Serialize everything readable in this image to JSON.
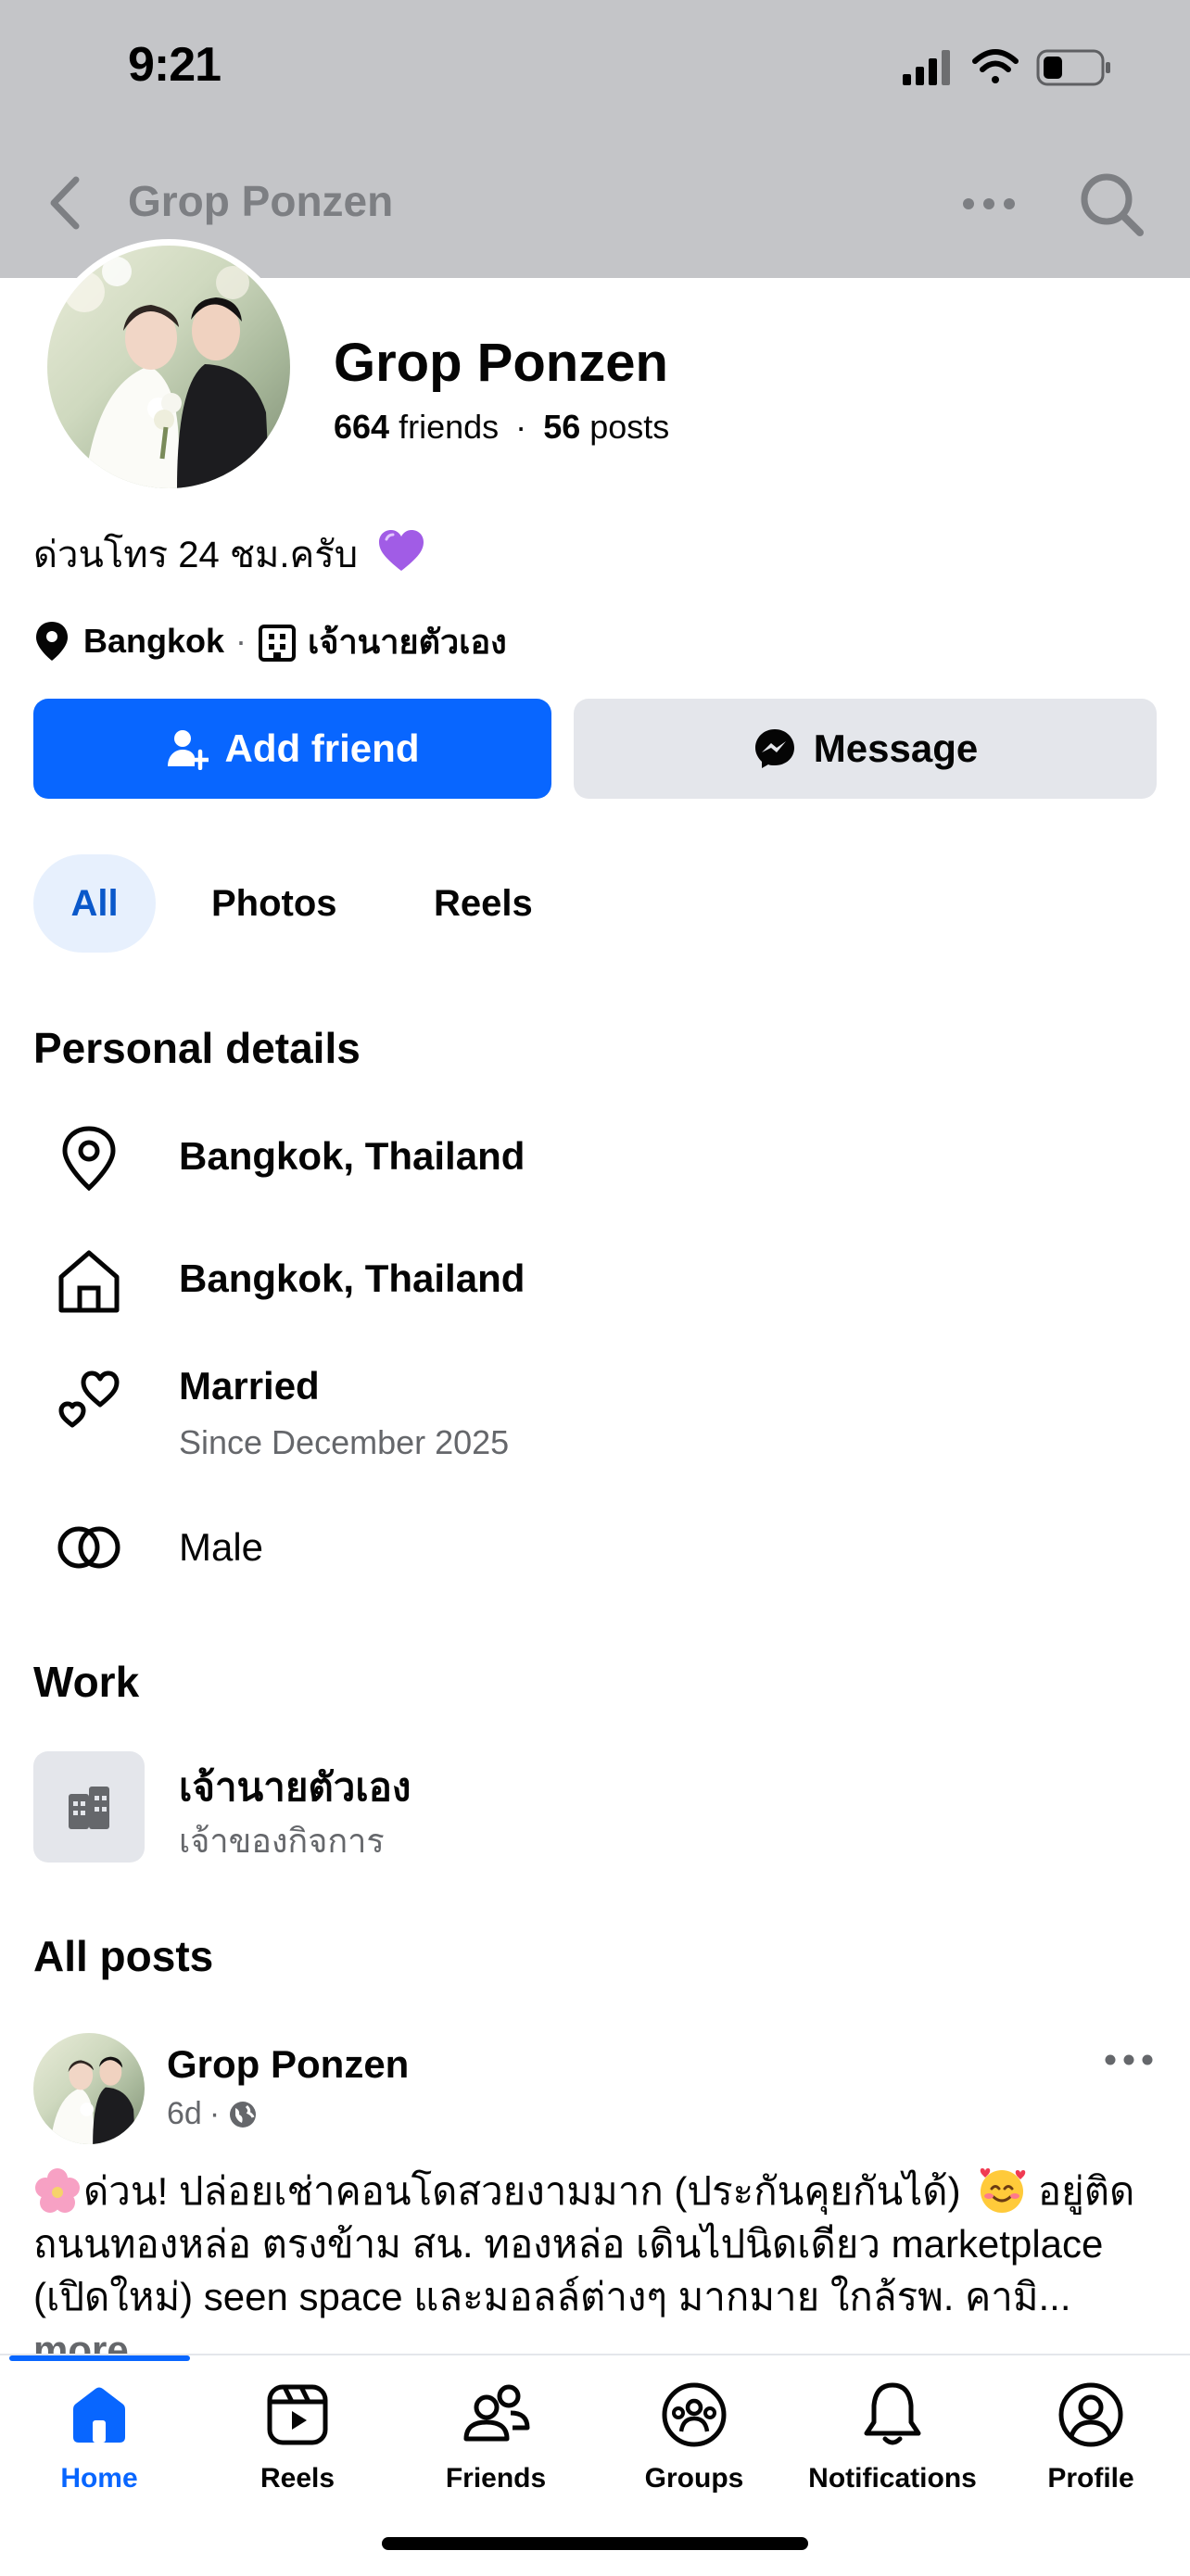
{
  "status_bar": {
    "time": "9:21"
  },
  "nav": {
    "title": "Grop Ponzen"
  },
  "profile": {
    "name": "Grop Ponzen",
    "friends_count": "664",
    "friends_label": "friends",
    "dot": "·",
    "posts_count": "56",
    "posts_label": "posts",
    "bio": "ด่วนโทร 24 ชม.ครับ",
    "location": "Bangkok",
    "separator": "·",
    "workplace": "เจ้านายตัวเอง"
  },
  "actions": {
    "add_friend": "Add friend",
    "message": "Message"
  },
  "filters": {
    "all": "All",
    "photos": "Photos",
    "reels": "Reels"
  },
  "personal_details": {
    "title": "Personal details",
    "current_city": "Bangkok, Thailand",
    "hometown": "Bangkok, Thailand",
    "relationship": "Married",
    "relationship_since": "Since December 2025",
    "gender": "Male"
  },
  "work": {
    "title": "Work",
    "employer": "เจ้านายตัวเอง",
    "position": "เจ้าของกิจการ"
  },
  "all_posts": {
    "title": "All posts",
    "post": {
      "author": "Grop Ponzen",
      "time": "6d",
      "meta_dot": "·",
      "text_line1": "ด่วน! ปล่อยเช่าคอนโดสวยงามมาก  (ประกันคุยกันได้)",
      "text_line1_tail": " อยู่ติด",
      "text_line2": "ถนนทองหล่อ ตรงข้าม สน. ทองหล่อ เดินไปนิดเดียว marketplace",
      "text_line3": "(เปิดใหม่) seen space และมอลล์ต่างๆ มากมาย ใกล้รพ. คามิ...",
      "more": "more"
    }
  },
  "tabbar": {
    "home": "Home",
    "reels": "Reels",
    "friends": "Friends",
    "groups": "Groups",
    "notifications": "Notifications",
    "profile": "Profile"
  },
  "colors": {
    "accent": "#0866ff",
    "secondary_button": "#e4e6eb",
    "muted_text": "#65676b"
  }
}
